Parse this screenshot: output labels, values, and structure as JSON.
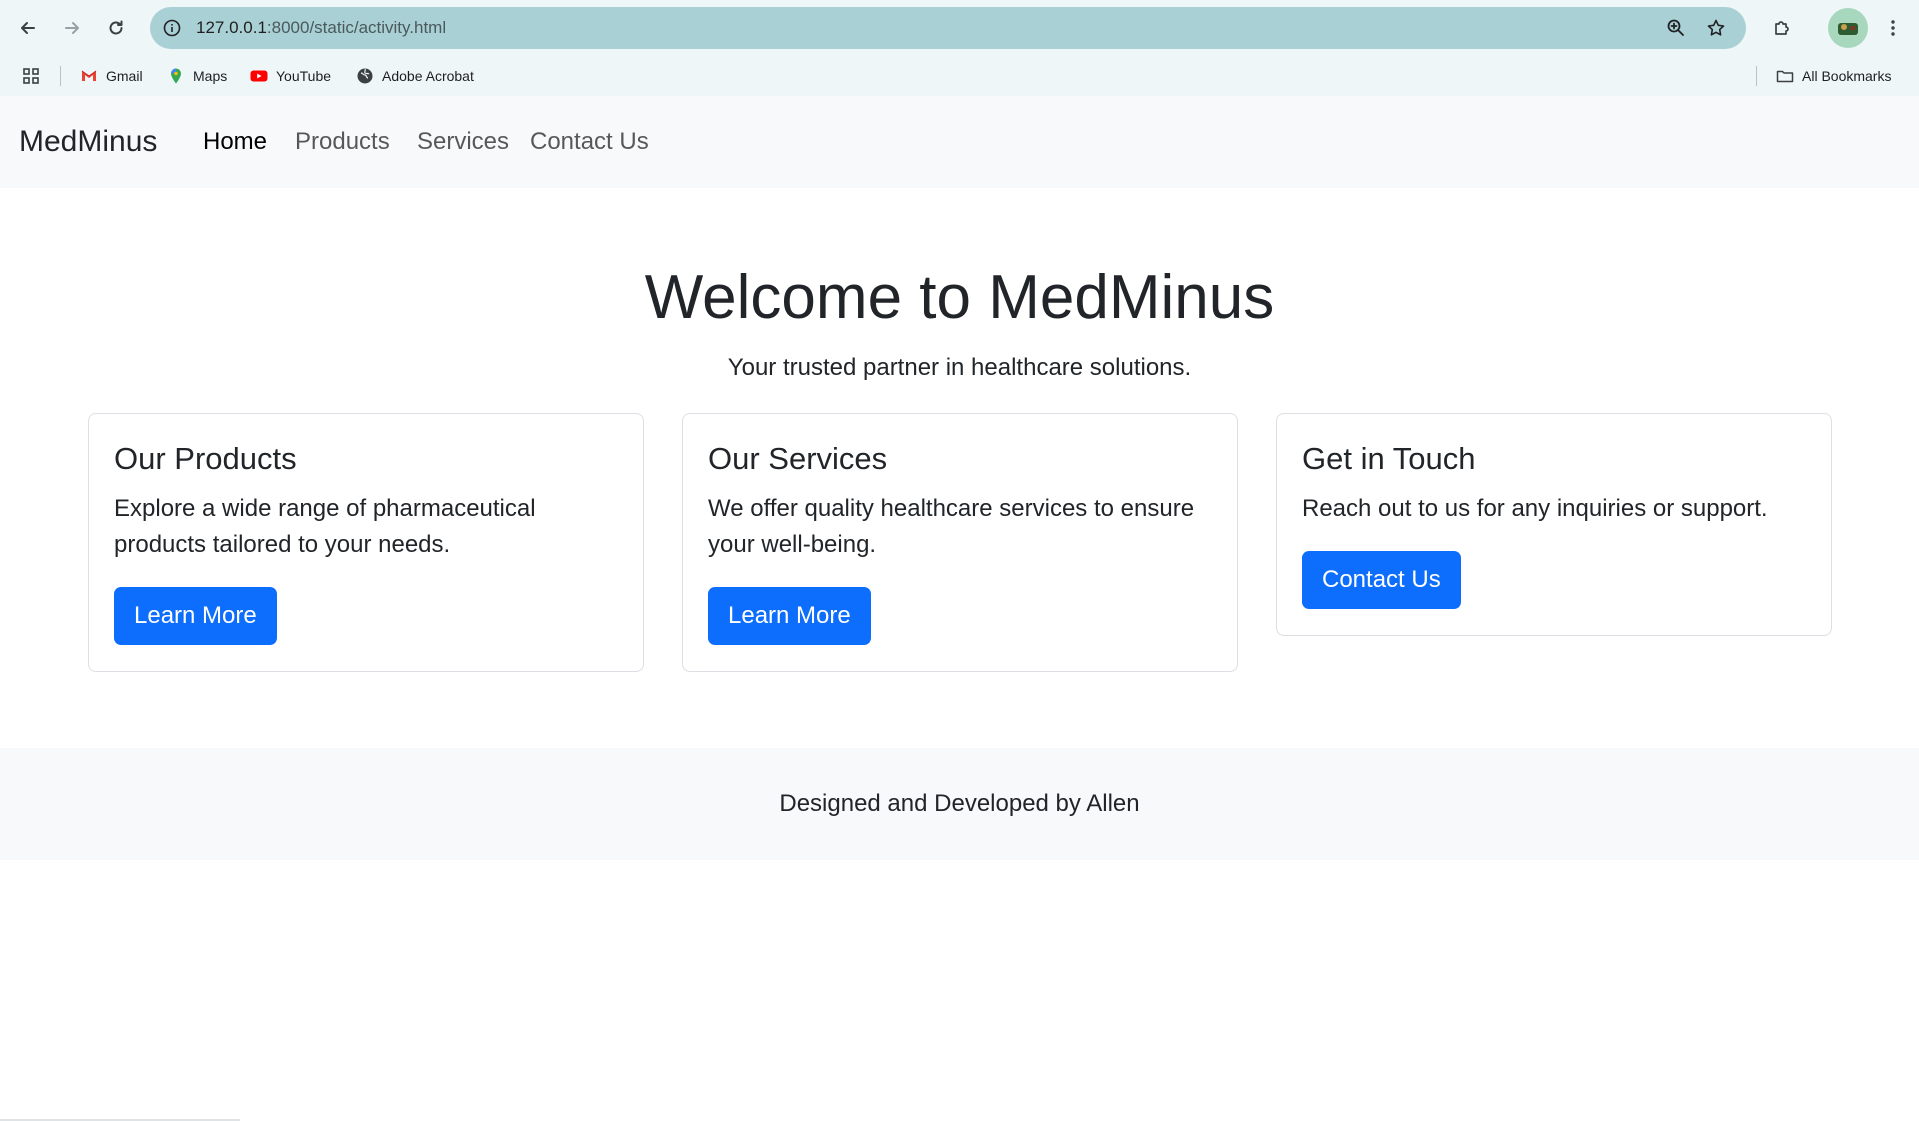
{
  "browser": {
    "url_host": "127.0.0.1",
    "url_rest": ":8000/static/activity.html",
    "bookmarks": [
      {
        "label": "Gmail",
        "icon": "gmail-icon"
      },
      {
        "label": "Maps",
        "icon": "maps-icon"
      },
      {
        "label": "YouTube",
        "icon": "youtube-icon"
      },
      {
        "label": "Adobe Acrobat",
        "icon": "globe-icon"
      }
    ],
    "all_bookmarks": "All Bookmarks"
  },
  "nav": {
    "brand": "MedMinus",
    "links": [
      {
        "label": "Home",
        "active": true
      },
      {
        "label": "Products",
        "active": false
      },
      {
        "label": "Services",
        "active": false
      },
      {
        "label": "Contact Us",
        "active": false
      }
    ]
  },
  "hero": {
    "title": "Welcome to MedMinus",
    "subtitle": "Your trusted partner in healthcare solutions."
  },
  "cards": [
    {
      "title": "Our Products",
      "text": "Explore a wide range of pharmaceutical products tailored to your needs.",
      "button": "Learn More"
    },
    {
      "title": "Our Services",
      "text": "We offer quality healthcare services to ensure your well-being.",
      "button": "Learn More"
    },
    {
      "title": "Get in Touch",
      "text": "Reach out to us for any inquiries or support.",
      "button": "Contact Us"
    }
  ],
  "footer": {
    "text": "Designed and Developed by Allen"
  },
  "colors": {
    "primary": "#0d6efd",
    "nav_bg": "#f8f9fa",
    "omnibox": "#a9d0d4"
  }
}
